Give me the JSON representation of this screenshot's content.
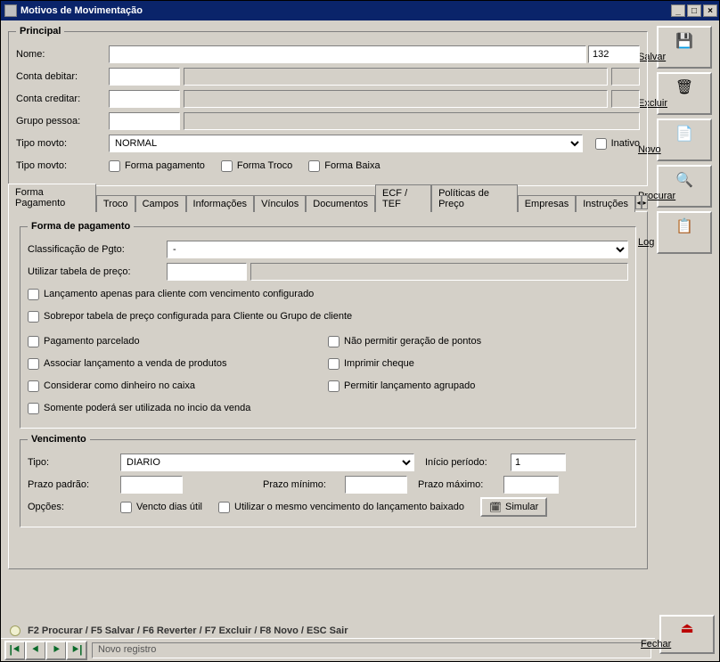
{
  "window": {
    "title": "Motivos de Movimentação"
  },
  "sidebar": {
    "save": "Salvar",
    "delete": "Excluir",
    "new": "Novo",
    "search": "Procurar",
    "log": "Log",
    "close": "Fechar"
  },
  "principal": {
    "legend": "Principal",
    "nome_label": "Nome:",
    "nome_value": "",
    "code_value": "132",
    "conta_debitar_label": "Conta debitar:",
    "conta_debitar_code": "",
    "conta_debitar_desc": "",
    "conta_creditar_label": "Conta creditar:",
    "conta_creditar_code": "",
    "conta_creditar_desc": "",
    "grupo_pessoa_label": "Grupo pessoa:",
    "grupo_pessoa_code": "",
    "grupo_pessoa_desc": "",
    "tipo_movto_label": "Tipo movto:",
    "tipo_movto_value": "NORMAL",
    "inativo_label": "Inativo",
    "tipo_movto2_label": "Tipo movto:",
    "forma_pagamento_chk": "Forma pagamento",
    "forma_troco_chk": "Forma Troco",
    "forma_baixa_chk": "Forma Baixa"
  },
  "tabs": {
    "items": [
      "Forma Pagamento",
      "Troco",
      "Campos",
      "Informações",
      "Vínculos",
      "Documentos",
      "ECF / TEF",
      "Políticas de Preço",
      "Empresas",
      "Instruções"
    ]
  },
  "forma_pagamento": {
    "legend": "Forma de pagamento",
    "classificacao_label": "Classificação de Pgto:",
    "classificacao_value": "-",
    "utilizar_tabela_label": "Utilizar tabela de preço:",
    "utilizar_tabela_code": "",
    "utilizar_tabela_desc": "",
    "chk_lanc_cliente": "Lançamento apenas para cliente com vencimento configurado",
    "chk_sobrepor": "Sobrepor tabela de preço configurada para Cliente ou Grupo de cliente",
    "chk_parcelado": "Pagamento parcelado",
    "chk_nao_pontos": "Não permitir geração de pontos",
    "chk_associar": "Associar lançamento a venda de produtos",
    "chk_imprimir_cheque": "Imprimir cheque",
    "chk_considerar_dinheiro": "Considerar como dinheiro no caixa",
    "chk_permitir_agrupado": "Permitir lançamento agrupado",
    "chk_somente_inicio": "Somente poderá ser utilizada no incio da venda"
  },
  "vencimento": {
    "legend": "Vencimento",
    "tipo_label": "Tipo:",
    "tipo_value": "DIARIO",
    "inicio_periodo_label": "Início período:",
    "inicio_periodo_value": "1",
    "prazo_padrao_label": "Prazo padrão:",
    "prazo_padrao_value": "",
    "prazo_minimo_label": "Prazo mínimo:",
    "prazo_minimo_value": "",
    "prazo_maximo_label": "Prazo máximo:",
    "prazo_maximo_value": "",
    "opcoes_label": "Opções:",
    "chk_vencto_dias_util": "Vencto dias útil",
    "chk_utilizar_mesmo": "Utilizar o mesmo vencimento do lançamento baixado",
    "btn_simular": "Simular"
  },
  "shortcuts": "F2 Procurar / F5 Salvar / F6 Reverter / F7 Excluir / F8 Novo / ESC Sair",
  "nav": {
    "status": "Novo registro"
  }
}
